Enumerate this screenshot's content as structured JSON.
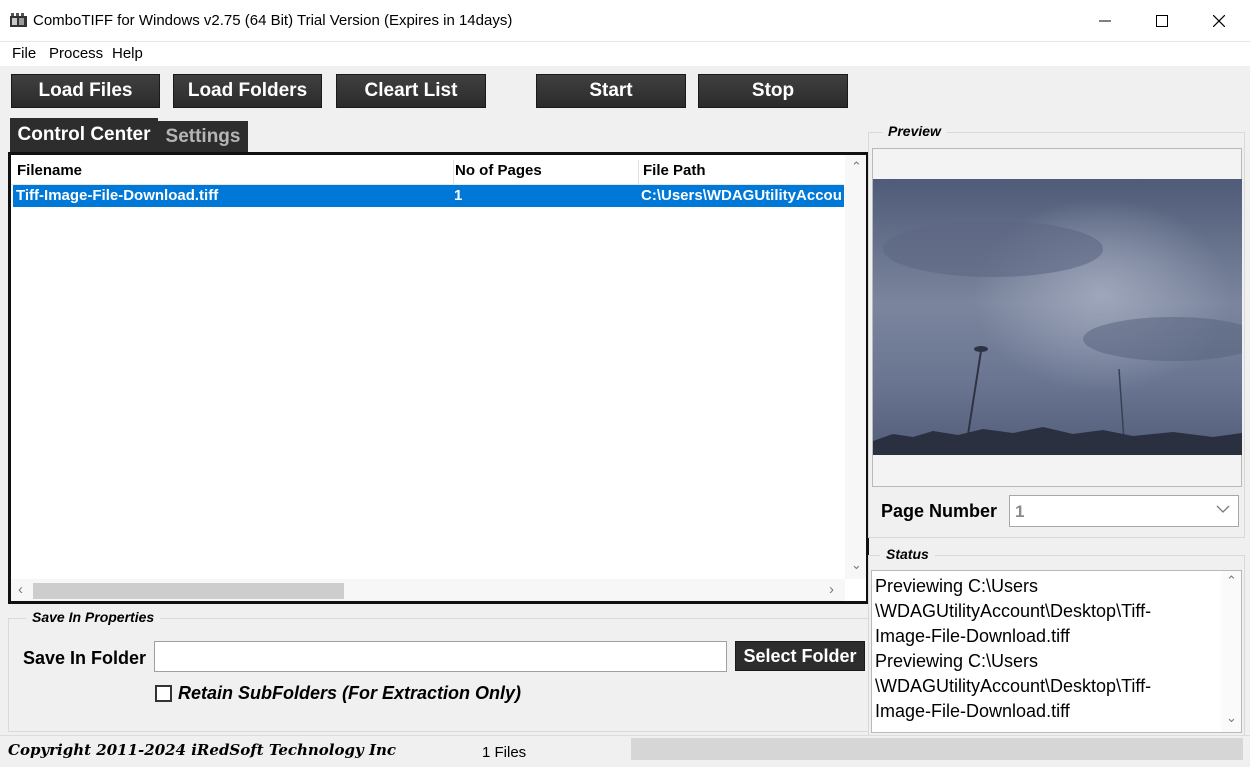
{
  "window": {
    "title": "ComboTIFF for Windows v2.75 (64 Bit)  Trial Version (Expires in 14days)",
    "icon": "film-strip-icon"
  },
  "menu": [
    "File",
    "Process",
    "Help"
  ],
  "toolbar": {
    "load_files": "Load Files",
    "load_folders": "Load Folders",
    "clear_list": "Cleart List",
    "start": "Start",
    "stop": "Stop"
  },
  "tabs": {
    "active": "Control Center",
    "inactive": "Settings"
  },
  "file_list": {
    "columns": [
      "Filename",
      "No of Pages",
      "File Path"
    ],
    "rows": [
      {
        "filename": "Tiff-Image-File-Download.tiff",
        "pages": "1",
        "path": "C:\\Users\\WDAGUtilityAccount\\Desktop\\Tiff-Image-File-Download.tiff",
        "selected": true
      }
    ]
  },
  "save_props": {
    "group_label": "Save In Properties",
    "folder_label": "Save In Folder",
    "folder_value": "",
    "select_folder": "Select Folder",
    "retain_label": "Retain SubFolders (For Extraction Only)",
    "retain_checked": false
  },
  "preview": {
    "group_label": "Preview",
    "image_subject": "cloudy sky over city skyline with lamp towers",
    "page_number_label": "Page Number",
    "page_number_value": "1"
  },
  "status": {
    "group_label": "Status",
    "lines": [
      "Previewing C:\\Users",
      "\\WDAGUtilityAccount\\Desktop\\Tiff-",
      "Image-File-Download.tiff",
      "Previewing C:\\Users",
      "\\WDAGUtilityAccount\\Desktop\\Tiff-",
      "Image-File-Download.tiff"
    ]
  },
  "footer": {
    "copyright": "Copyright 2011-2024 iRedSoft Technology Inc",
    "file_count": "1 Files",
    "progress": 0
  },
  "colors": {
    "button_bg": "#2d2d2d",
    "selection": "#0078d7",
    "window_bg": "#f0f0f0"
  }
}
